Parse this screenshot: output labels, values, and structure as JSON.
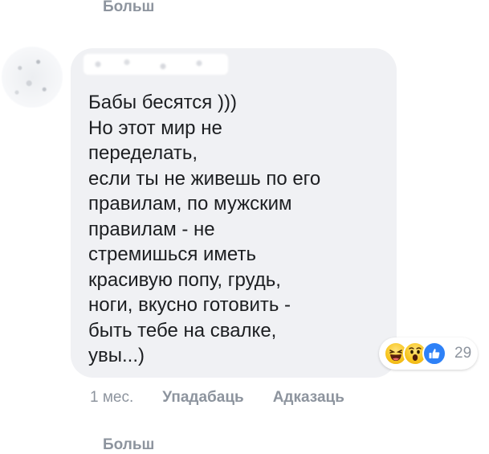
{
  "more_top_label": "Больш",
  "comment": {
    "text": "Бабы бесятся )))\nНо этот мир не\nпеределать,\nесли ты не живешь по его\nправилам, по мужским\nправилам - не\nстремишься иметь\nкрасивую попу, грудь,\nноги, вкусно готовить -\nбыть тебе на свалке,\nувы...)",
    "time": "1 мес.",
    "like_label": "Упадабаць",
    "reply_label": "Адказаць"
  },
  "reactions": {
    "icons": [
      "haha-icon",
      "wow-icon",
      "like-icon"
    ],
    "count": "29"
  },
  "more_bottom_label": "Больш",
  "colors": {
    "bubble": "#f0f1f4",
    "text": "#1c1e21",
    "secondary": "#8d949e",
    "like_blue": "#2e81f7",
    "reaction_yellow": "#f7c51e"
  }
}
